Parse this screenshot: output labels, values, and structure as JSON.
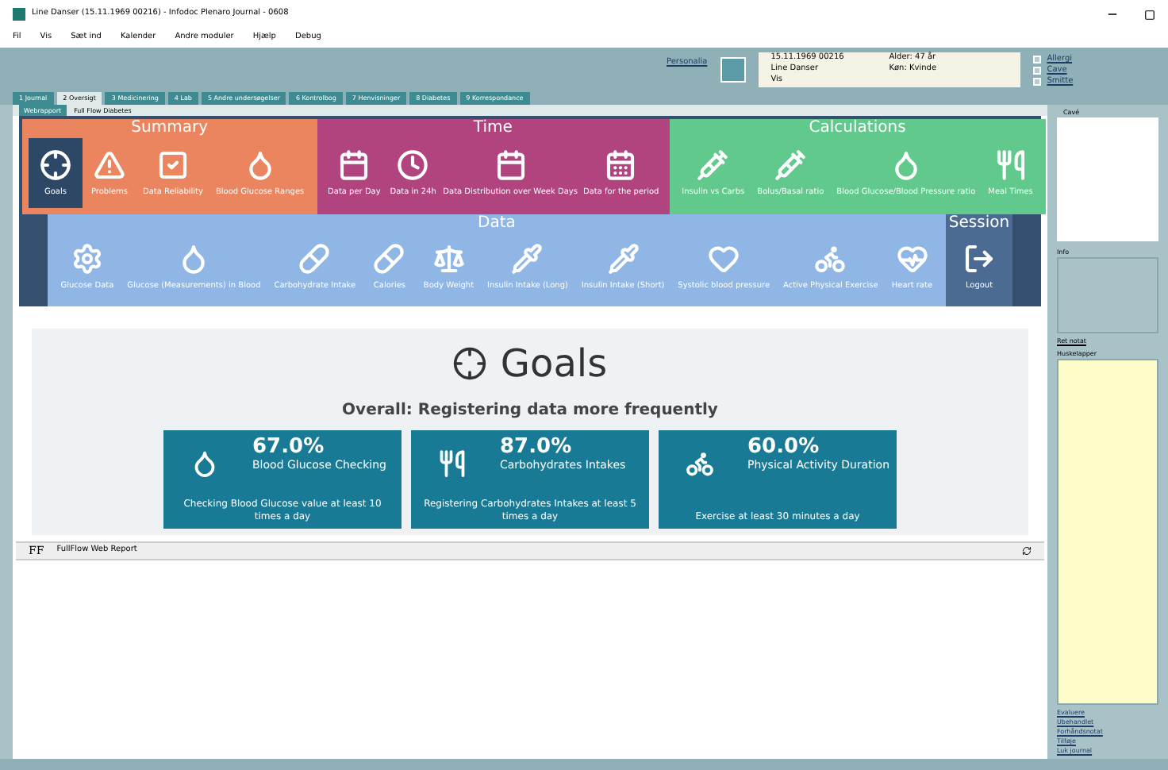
{
  "window": {
    "title": "Line Danser (15.11.1969 00216) - Infodoc Plenaro Journal - 0608"
  },
  "menu": [
    "Fil",
    "Vis",
    "Sæt ind",
    "Kalender",
    "Andre moduler",
    "Hjælp",
    "Debug"
  ],
  "patient": {
    "label": "Personalia",
    "birth": "15.11.1969 00216",
    "name": "Line Danser",
    "extra": "Vis",
    "age": "Alder: 47 år",
    "sex": "Køn: Kvinde"
  },
  "flags": [
    {
      "label": "Allergi",
      "checked": false
    },
    {
      "label": "Cave",
      "checked": false
    },
    {
      "label": "Smitte",
      "checked": false
    }
  ],
  "tabs": [
    {
      "label": "1 Journal",
      "selected": false
    },
    {
      "label": "2 Oversigt",
      "selected": true
    },
    {
      "label": "3 Medicinering",
      "selected": false
    },
    {
      "label": "4 Lab",
      "selected": false
    },
    {
      "label": "5 Andre undersøgelser",
      "selected": false
    },
    {
      "label": "6 Kontrolbog",
      "selected": false
    },
    {
      "label": "7 Henvisninger",
      "selected": false
    },
    {
      "label": "8 Diabetes",
      "selected": false
    },
    {
      "label": "9 Korrespondance",
      "selected": false
    }
  ],
  "subtabs": [
    {
      "label": "Webrapport",
      "selected": true
    },
    {
      "label": "Full Flow Diabetes",
      "selected": false
    }
  ],
  "sections": [
    {
      "title": "Summary",
      "color": "#ea8560",
      "items": [
        {
          "label": "Goals",
          "selected": true
        },
        {
          "label": "Problems",
          "selected": false
        },
        {
          "label": "Data Reliability",
          "selected": false
        },
        {
          "label": "Blood Glucose Ranges",
          "selected": false
        }
      ]
    },
    {
      "title": "Time",
      "color": "#b1437f",
      "items": [
        {
          "label": "Data per Day",
          "selected": false
        },
        {
          "label": "Data in 24h",
          "selected": false
        },
        {
          "label": "Data Distribution over Week Days",
          "selected": false
        },
        {
          "label": "Data for the period",
          "selected": false
        }
      ]
    },
    {
      "title": "Calculations",
      "color": "#60c98b",
      "items": [
        {
          "label": "Insulin vs Carbs",
          "selected": false
        },
        {
          "label": "Bolus/Basal ratio",
          "selected": false
        },
        {
          "label": "Blood Glucose/Blood Pressure ratio",
          "selected": false
        },
        {
          "label": "Meal Times",
          "selected": false
        }
      ]
    },
    {
      "title": "Data",
      "color": "#8fb6e4",
      "items": [
        {
          "label": "Glucose Data",
          "selected": false
        },
        {
          "label": "Glucose (Measurements) in Blood",
          "selected": false
        },
        {
          "label": "Carbohydrate Intake",
          "selected": false
        },
        {
          "label": "Calories",
          "selected": false
        },
        {
          "label": "Body Weight",
          "selected": false
        },
        {
          "label": "Insulin Intake (Long)",
          "selected": false
        },
        {
          "label": "Insulin Intake (Short)",
          "selected": false
        },
        {
          "label": "Systolic blood pressure",
          "selected": false
        },
        {
          "label": "Active Physical Exercise",
          "selected": false
        },
        {
          "label": "Heart rate",
          "selected": false
        }
      ]
    },
    {
      "title": "Session",
      "color": "#4b6b92",
      "items": [
        {
          "label": "Logout",
          "selected": false
        }
      ]
    }
  ],
  "goals": {
    "title": "Goals",
    "overall": "Overall: Registering data more frequently",
    "cards": [
      {
        "percent": "67.0%",
        "name": "Blood Glucose Checking",
        "note": "Checking Blood Glucose value at least 10 times a day"
      },
      {
        "percent": "87.0%",
        "name": "Carbohydrates Intakes",
        "note": "Registering Carbohydrates Intakes at least 5 times a day"
      },
      {
        "percent": "60.0%",
        "name": "Physical Activity Duration",
        "note": "Exercise at least 30 minutes a day"
      }
    ]
  },
  "report_bar": {
    "logo": "FF",
    "title": "FullFlow Web Report"
  },
  "side": {
    "top_label": "Cavé",
    "mid_label": "Info",
    "link1": "Ret notat",
    "notes_label": "Huskelapper",
    "links": [
      "Evaluere",
      "Ubehandlet",
      "Forhåndsnotat",
      "Tilføje",
      "Luk journal"
    ]
  }
}
